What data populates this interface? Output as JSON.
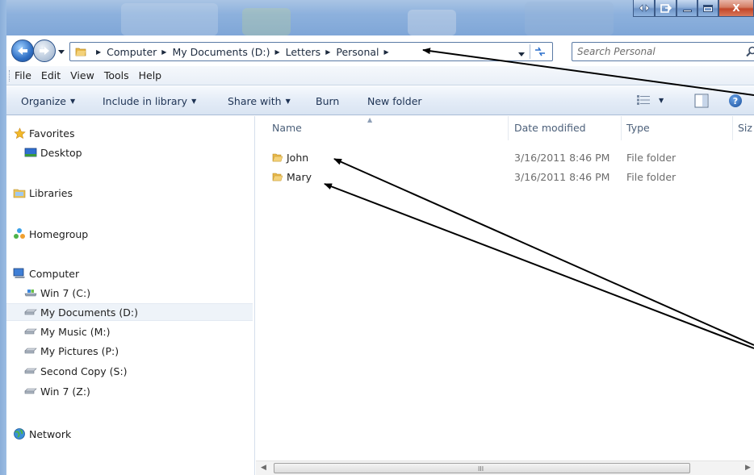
{
  "window": {
    "controls": {
      "minimize": "_",
      "close": "X"
    }
  },
  "address_bar": {
    "crumbs": [
      "Computer",
      "My Documents (D:)",
      "Letters",
      "Personal"
    ]
  },
  "search": {
    "placeholder": "Search Personal"
  },
  "menu": [
    "File",
    "Edit",
    "View",
    "Tools",
    "Help"
  ],
  "command_bar": {
    "organize": "Organize",
    "include_in_library": "Include in library",
    "share_with": "Share with",
    "burn": "Burn",
    "new_folder": "New folder"
  },
  "nav_pane": {
    "favorites": "Favorites",
    "desktop": "Desktop",
    "libraries": "Libraries",
    "homegroup": "Homegroup",
    "computer": "Computer",
    "drives": [
      "Win 7 (C:)",
      "My Documents (D:)",
      "My Music (M:)",
      "My Pictures (P:)",
      "Second Copy (S:)",
      "Win 7 (Z:)"
    ],
    "selected_drive": "My Documents (D:)",
    "network": "Network"
  },
  "file_list": {
    "columns": {
      "name": "Name",
      "date_modified": "Date modified",
      "type": "Type",
      "size": "Siz"
    },
    "rows": [
      {
        "name": "John",
        "date_modified": "3/16/2011 8:46 PM",
        "type": "File folder"
      },
      {
        "name": "Mary",
        "date_modified": "3/16/2011 8:46 PM",
        "type": "File folder"
      }
    ]
  },
  "colors": {
    "glass": "#8db1dd",
    "selection": "#eef3f9",
    "folder": "#e8b84a",
    "annotation": "#000000"
  },
  "scrollbar": {
    "grip": "III"
  }
}
